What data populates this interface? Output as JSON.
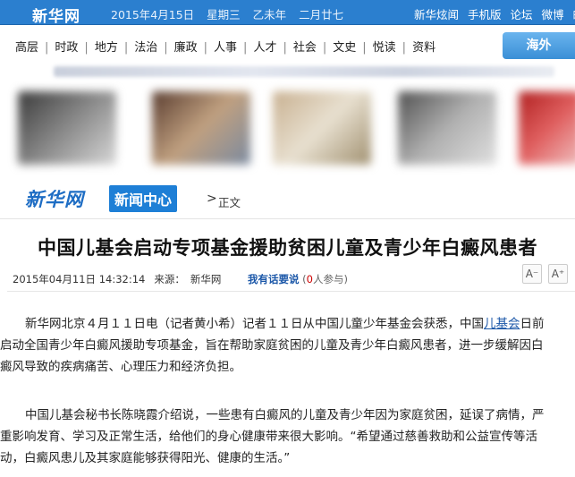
{
  "topbar": {
    "logo": "新华网",
    "date": "2015年4月15日",
    "weekday": "星期三",
    "lunar_year": "乙未年",
    "lunar_day": "二月廿七",
    "links": [
      "新华炫闻",
      "手机版",
      "论坛",
      "微博",
      "邮"
    ]
  },
  "nav": {
    "items": [
      "高层",
      "时政",
      "地方",
      "法治",
      "廉政",
      "人事",
      "人才",
      "社会",
      "文史",
      "悦读",
      "资料"
    ],
    "overseas": "海外"
  },
  "breadcrumb": {
    "brand": "新华网",
    "section": "新闻中心",
    "arrow": ">",
    "current": "正文"
  },
  "article": {
    "title": "中国儿基会启动专项基金援助贫困儿童及青少年白癜风患者",
    "datetime": "2015年04月11日 14:32:14",
    "source_label": "来源：",
    "source": "新华网",
    "comment_label": "我有话要说",
    "comment_count_prefix": "(",
    "comment_count": "0",
    "comment_count_suffix": "人参与)",
    "font_smaller": "A⁻",
    "font_larger": "A⁺",
    "p1": {
      "line1_a": "新华网北京４月１１日电（记者黄小希）记者１１日从中国儿童少年基金会获悉，中国",
      "line1_link": "儿基会",
      "line1_b": "日前",
      "line2": "启动全国青少年白癜风援助专项基金，旨在帮助家庭贫困的儿童及青少年白癜风患者，进一步缓解因白",
      "line3": "癜风导致的疾病痛苦、心理压力和经济负担。"
    },
    "p2": {
      "line1": "中国儿基会秘书长陈晓霞介绍说，一些患有白癜风的儿童及青少年因为家庭贫困，延误了病情，严",
      "line2": "重影响发育、学习及正常生活，给他们的身心健康带来很大影响。“希望通过慈善救助和公益宣传等活",
      "line3": "动，白癜风患儿及其家庭能够获得阳光、健康的生活。”"
    }
  }
}
